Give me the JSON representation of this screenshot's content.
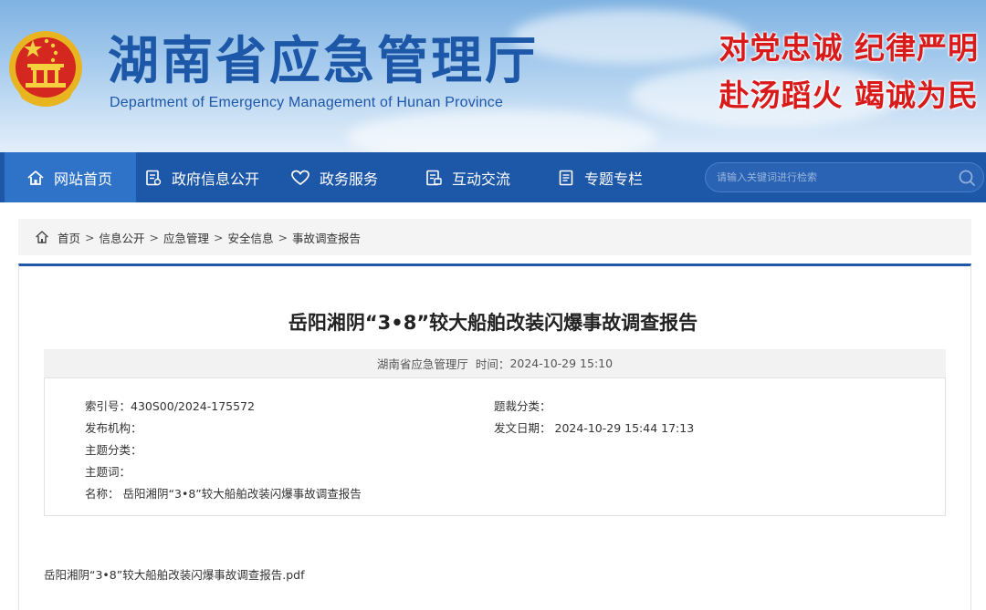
{
  "header": {
    "title": "湖南省应急管理厅",
    "subtitle": "Department of Emergency Management of Hunan Province",
    "slogan_line1": "对党忠诚  纪律严明",
    "slogan_line2": "赴汤蹈火  竭诚为民",
    "emblem": "national-emblem"
  },
  "nav": {
    "items": [
      {
        "label": "网站首页",
        "icon": "home-icon"
      },
      {
        "label": "政府信息公开",
        "icon": "document-icon"
      },
      {
        "label": "政务服务",
        "icon": "heart-icon"
      },
      {
        "label": "互动交流",
        "icon": "chat-document-icon"
      },
      {
        "label": "专题专栏",
        "icon": "list-document-icon"
      }
    ],
    "search_placeholder": "请输入关键词进行检索"
  },
  "breadcrumb": [
    "首页",
    "信息公开",
    "应急管理",
    "安全信息",
    "事故调查报告"
  ],
  "article": {
    "title": "岳阳湘阴“3•8”较大船舶改装闪爆事故调查报告",
    "publisher": "湖南省应急管理厅",
    "time_label": "时间：",
    "time": "2024-10-29 15:10"
  },
  "info": {
    "index_label": "索引号：",
    "index_value": "430S00/2024-175572",
    "genre_label": "题裁分类：",
    "genre_value": "",
    "org_label": "发布机构：",
    "org_value": "",
    "date_label": "发文日期：",
    "date_value": "2024-10-29 15:44 17:13",
    "topic_label": "主题分类：",
    "topic_value": "",
    "keyword_label": "主题词：",
    "keyword_value": "",
    "name_label": "名称：",
    "name_value": "岳阳湘阴“3•8”较大船舶改装闪爆事故调查报告"
  },
  "attachment": "岳阳湘阴“3•8”较大船舶改装闪爆事故调查报告.pdf",
  "colors": {
    "brand_blue": "#1d57a8",
    "nav_active": "#2f73c8",
    "slogan_red": "#d91a1a"
  }
}
